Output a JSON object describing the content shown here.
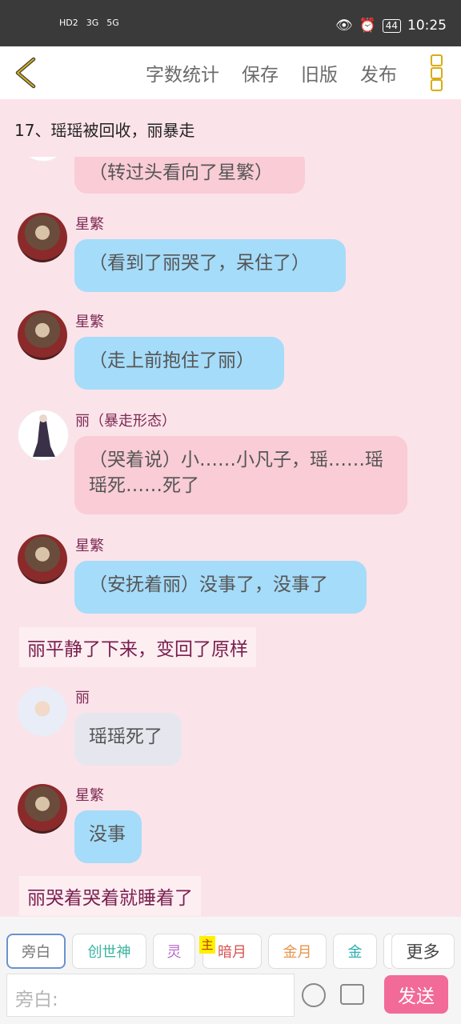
{
  "status_bar": {
    "left": [
      "HD2",
      "3G",
      "5G"
    ],
    "battery": "44",
    "time": "10:25"
  },
  "toolbar": {
    "back_icon": "chevron-left-icon",
    "items": [
      "字数统计",
      "保存",
      "旧版",
      "发布"
    ],
    "more_icon": "three-square-dots-icon"
  },
  "chapter_title": "17、瑶瑶被回收，丽暴走",
  "messages": [
    {
      "type": "bubble",
      "style": "pink",
      "text": "（转过头看向了星繁）"
    },
    {
      "type": "bubble",
      "style": "blue",
      "name": "星繁",
      "text": "（看到了丽哭了，呆住了）"
    },
    {
      "type": "bubble",
      "style": "blue",
      "name": "星繁",
      "text": "（走上前抱住了丽）"
    },
    {
      "type": "bubble",
      "style": "pink",
      "name": "丽（暴走形态）",
      "text": "（哭着说）小……小凡子，瑶……瑶瑶死……死了"
    },
    {
      "type": "bubble",
      "style": "blue",
      "name": "星繁",
      "text": "（安抚着丽）没事了，没事了"
    },
    {
      "type": "narration",
      "text": "丽平静了下来，变回了原样"
    },
    {
      "type": "bubble",
      "style": "gray",
      "name": "丽",
      "text": "瑶瑶死了"
    },
    {
      "type": "bubble",
      "style": "blue",
      "name": "星繁",
      "text": "没事"
    },
    {
      "type": "narration",
      "text": "丽哭着哭着就睡着了"
    }
  ],
  "role_tabs": [
    {
      "label": "旁白",
      "color": "#777777"
    },
    {
      "label": "创世神",
      "color": "#3bb5a3"
    },
    {
      "label": "灵",
      "color": "#b56cc8"
    },
    {
      "label": "暗月",
      "color": "#d9534f"
    },
    {
      "label": "金月",
      "color": "#e8934a"
    },
    {
      "label": "金",
      "color": "#2bb0b0"
    },
    {
      "label": "更多",
      "color": "#444444"
    }
  ],
  "main_badge": "主",
  "input_placeholder": "旁白:",
  "send_label": "发送"
}
